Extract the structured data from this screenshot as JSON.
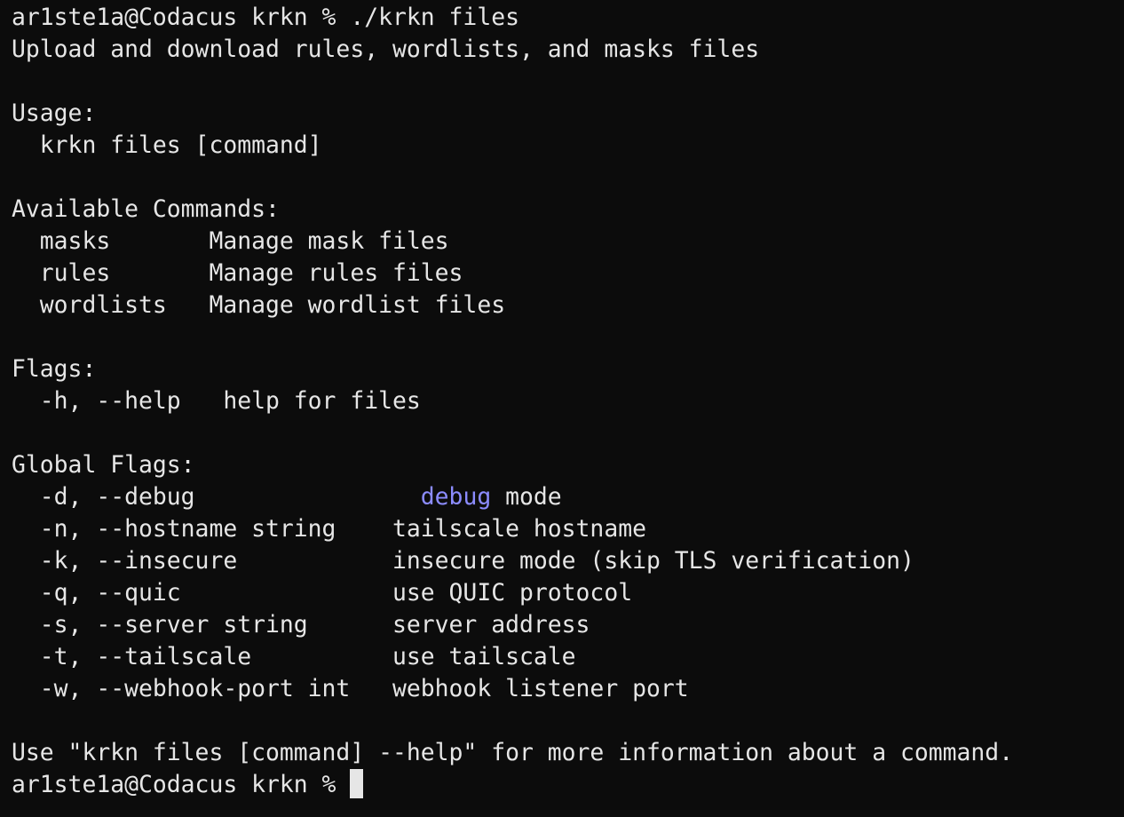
{
  "colors": {
    "background": "#0c0c0c",
    "foreground": "#e6e6e6",
    "highlight": "#8c8cff"
  },
  "terminal": {
    "prompt_command": "ar1ste1a@Codacus krkn % ./krkn files",
    "description": "Upload and download rules, wordlists, and masks files",
    "usage_heading": "Usage:",
    "usage_line": "  krkn files [command]",
    "commands_heading": "Available Commands:",
    "commands": [
      {
        "line": "  masks       Manage mask files"
      },
      {
        "line": "  rules       Manage rules files"
      },
      {
        "line": "  wordlists   Manage wordlist files"
      }
    ],
    "flags_heading": "Flags:",
    "flags": [
      {
        "line": "  -h, --help   help for files"
      }
    ],
    "global_flags_heading": "Global Flags:",
    "global_flags": {
      "debug": {
        "prefix": "  -d, --debug                ",
        "highlight": "debug",
        "suffix": " mode"
      },
      "rest": [
        {
          "line": "  -n, --hostname string    tailscale hostname"
        },
        {
          "line": "  -k, --insecure           insecure mode (skip TLS verification)"
        },
        {
          "line": "  -q, --quic               use QUIC protocol"
        },
        {
          "line": "  -s, --server string      server address"
        },
        {
          "line": "  -t, --tailscale          use tailscale"
        },
        {
          "line": "  -w, --webhook-port int   webhook listener port"
        }
      ]
    },
    "footer_help": "Use \"krkn files [command] --help\" for more information about a command.",
    "final_prompt": "ar1ste1a@Codacus krkn % "
  }
}
